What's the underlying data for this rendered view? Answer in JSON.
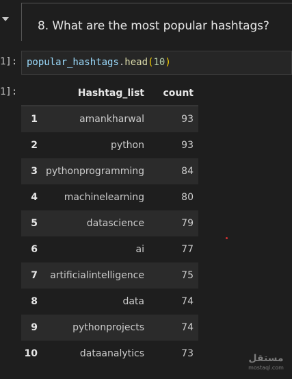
{
  "markdown_cell": {
    "heading": "8. What are the most popular hashtags?"
  },
  "input_cell": {
    "prompt": "1]:",
    "code": {
      "name": "popular_hashtags",
      "dot": ".",
      "fn": "head",
      "open": "(",
      "arg": "10",
      "close": ")"
    }
  },
  "output_cell": {
    "prompt": "1]:",
    "table": {
      "columns": [
        "",
        "Hashtag_list",
        "count"
      ],
      "rows": [
        {
          "index": "1",
          "tag": "amankharwal",
          "count": "93"
        },
        {
          "index": "2",
          "tag": "python",
          "count": "93"
        },
        {
          "index": "3",
          "tag": "pythonprogramming",
          "count": "84"
        },
        {
          "index": "4",
          "tag": "machinelearning",
          "count": "80"
        },
        {
          "index": "5",
          "tag": "datascience",
          "count": "79"
        },
        {
          "index": "6",
          "tag": "ai",
          "count": "77"
        },
        {
          "index": "7",
          "tag": "artificialintelligence",
          "count": "75"
        },
        {
          "index": "8",
          "tag": "data",
          "count": "74"
        },
        {
          "index": "9",
          "tag": "pythonprojects",
          "count": "74"
        },
        {
          "index": "10",
          "tag": "dataanalytics",
          "count": "73"
        }
      ]
    }
  },
  "watermark": {
    "script": "مستقل",
    "latin": "mostaql.com"
  },
  "colors": {
    "background": "#1e1e1e",
    "row_alt": "#2b2b2b",
    "function": "#dcdcaa",
    "variable": "#9cdcfe",
    "number": "#b5cea8",
    "bracket": "#ffd700"
  },
  "icons": {
    "collapse": "chevron-down-icon"
  }
}
